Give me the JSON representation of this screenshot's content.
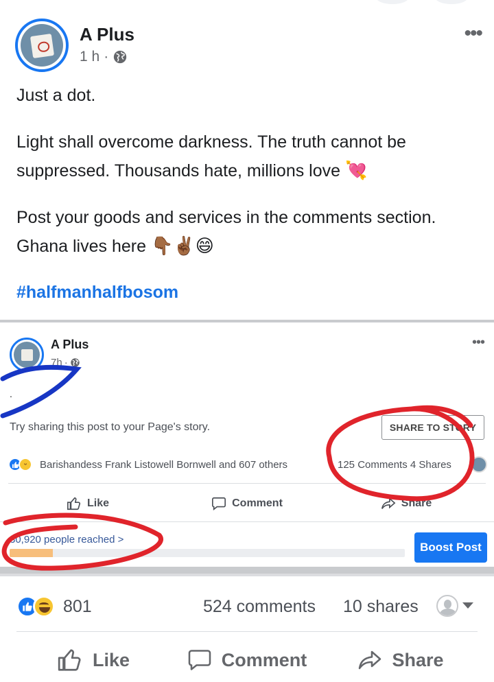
{
  "post": {
    "page_name": "A Plus",
    "time": "1 h",
    "separator": "·",
    "paragraphs": [
      "Just a dot.",
      "Light shall overcome darkness. The truth cannot be suppressed. Thousands hate, millions love",
      "Post your goods and services in the comments section. Ghana lives here"
    ],
    "emoji_love": "💘",
    "emoji_tail": "👇🏾✌🏾😄",
    "hashtag": "#halfmanhalfbosom"
  },
  "shared_screenshot": {
    "page_name": "A Plus",
    "time": "7h",
    "separator": "·",
    "post_text": ".",
    "story_prompt": "Try sharing this post to your Page's story.",
    "share_to_story_label": "SHARE TO STORY",
    "reactors": "Barishandess Frank Listowell Bornwell and 607 others",
    "counts": "125 Comments 4 Shares",
    "actions": {
      "like": "Like",
      "comment": "Comment",
      "share": "Share"
    },
    "reached": "30,920 people reached",
    "reached_chevron": ">",
    "reach_progress_fraction": 0.11,
    "boost_label": "Boost Post"
  },
  "reactions": {
    "count": "801",
    "comments": "524 comments",
    "shares": "10 shares"
  },
  "actions": {
    "like": "Like",
    "comment": "Comment",
    "share": "Share"
  },
  "colors": {
    "brand_blue": "#1877f2",
    "hashtag_blue": "#1b74e4",
    "annotation_red": "#e0242b",
    "annotation_blue": "#1736c4"
  }
}
